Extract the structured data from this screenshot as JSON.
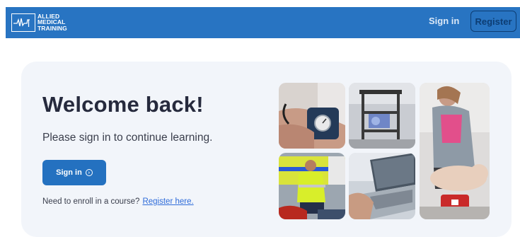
{
  "header": {
    "logo_lines": [
      "ALLIED",
      "MEDICAL",
      "TRAINING"
    ],
    "logo_icon": "heartbeat-logo-icon",
    "signin_label": "Sign in",
    "register_label": "Register",
    "accent_color": "#2874c2"
  },
  "main": {
    "title": "Welcome back!",
    "subtitle": "Please sign in to continue learning.",
    "signin_button_label": "Sign in",
    "signin_button_icon": "arrow-circle-right-icon",
    "enroll_prompt": "Need to enroll in a course?",
    "register_link": "Register here."
  },
  "photos": [
    {
      "name": "blood-pressure-photo"
    },
    {
      "name": "equipment-trolley-photo"
    },
    {
      "name": "cpr-training-photo"
    },
    {
      "name": "paramedic-scene-photo"
    },
    {
      "name": "laptop-photo"
    }
  ]
}
